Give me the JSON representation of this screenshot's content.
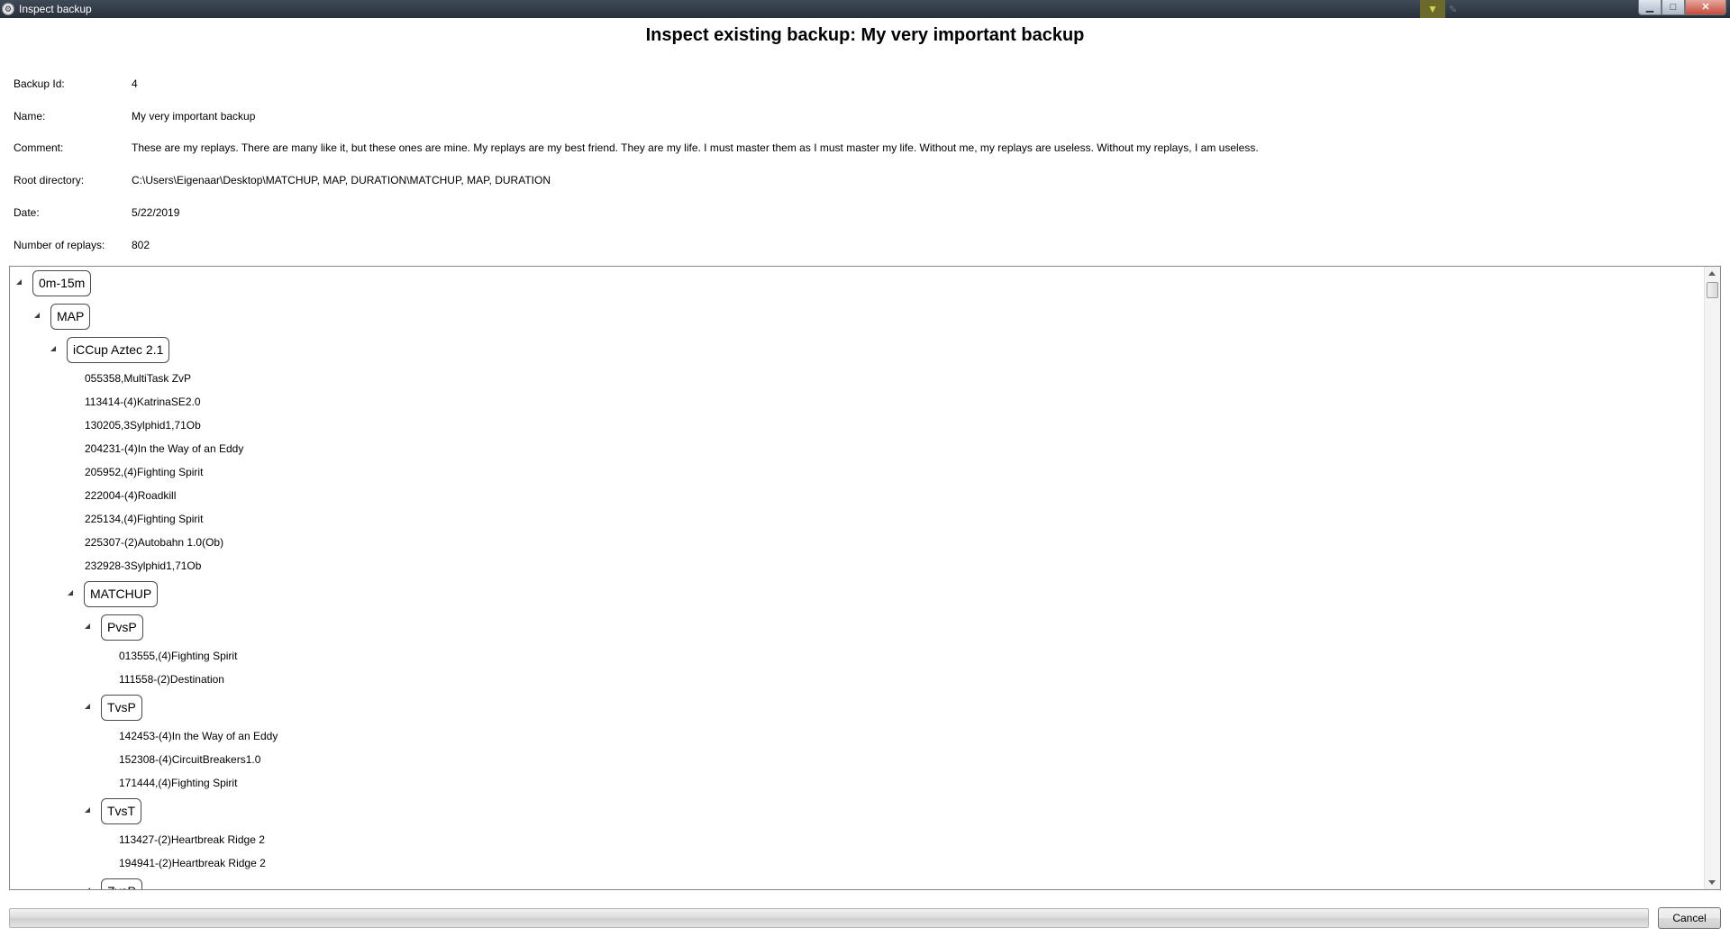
{
  "window": {
    "title": "Inspect backup",
    "buttons": {
      "minimize": "▁",
      "maximize": "□",
      "close": "✕"
    }
  },
  "heading": "Inspect existing backup: My very important backup",
  "info": [
    {
      "label": "Backup Id:",
      "value": "4"
    },
    {
      "label": "Name:",
      "value": "My very important backup"
    },
    {
      "label": "Comment:",
      "value": "These are my replays. There are many like it, but these ones are mine. My replays are my best friend. They are my life. I must master them as I must master my life. Without me, my replays are useless. Without my replays, I am useless."
    },
    {
      "label": "Root directory:",
      "value": "C:\\Users\\Eigenaar\\Desktop\\MATCHUP, MAP, DURATION\\MATCHUP, MAP, DURATION"
    },
    {
      "label": "Date:",
      "value": "5/22/2019"
    },
    {
      "label": "Number of replays:",
      "value": "802"
    }
  ],
  "tree": {
    "root": {
      "label": "0m-15m",
      "child": {
        "label": "MAP",
        "child": {
          "label": "iCCup  Aztec 2.1",
          "files": [
            "055358,MultiTask ZvP",
            "113414-(4)KatrinaSE2.0",
            "130205,3Sylphid1,71Ob",
            "204231-(4)In the Way of an Eddy",
            "205952,(4)Fighting Spirit",
            "222004-(4)Roadkill",
            "225134,(4)Fighting Spirit",
            "225307-(2)Autobahn 1.0(Ob)",
            "232928-3Sylphid1,71Ob"
          ],
          "matchup": {
            "label": "MATCHUP",
            "groups": [
              {
                "label": "PvsP",
                "files": [
                  "013555,(4)Fighting Spirit",
                  "111558-(2)Destination"
                ]
              },
              {
                "label": "TvsP",
                "files": [
                  "142453-(4)In the Way of an Eddy",
                  "152308-(4)CircuitBreakers1.0",
                  "171444,(4)Fighting Spirit"
                ]
              },
              {
                "label": "TvsT",
                "files": [
                  "113427-(2)Heartbreak Ridge 2",
                  "194941-(2)Heartbreak Ridge 2"
                ]
              },
              {
                "label": "ZvsP",
                "files": []
              }
            ]
          }
        }
      }
    }
  },
  "footer": {
    "progress": 0,
    "cancel_label": "Cancel"
  }
}
